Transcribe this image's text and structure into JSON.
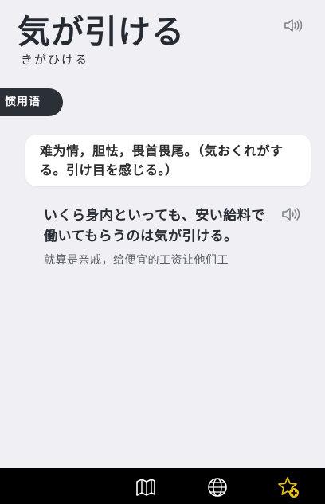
{
  "entry": {
    "headword": "気が引ける",
    "reading": "きがひける"
  },
  "tag": {
    "label": "惯用语"
  },
  "meaning": {
    "text": "难为情，胆怯，畏首畏尾。（気おくれがする。引け目を感じる。）"
  },
  "example": {
    "japanese": "いくら身内といっても、安い給料で働いてもらうのは気が引ける。",
    "chinese": "就算是亲戚，给便宜的工资让他们工"
  },
  "icons": {
    "speaker": "speaker-icon",
    "map": "map-icon",
    "globe": "globe-icon",
    "star_add": "star-add-icon"
  },
  "colors": {
    "background": "#f0eff4",
    "tag_bg": "#2b2f36",
    "bottom_bar": "#000000",
    "star_badge": "#e8c21a"
  }
}
